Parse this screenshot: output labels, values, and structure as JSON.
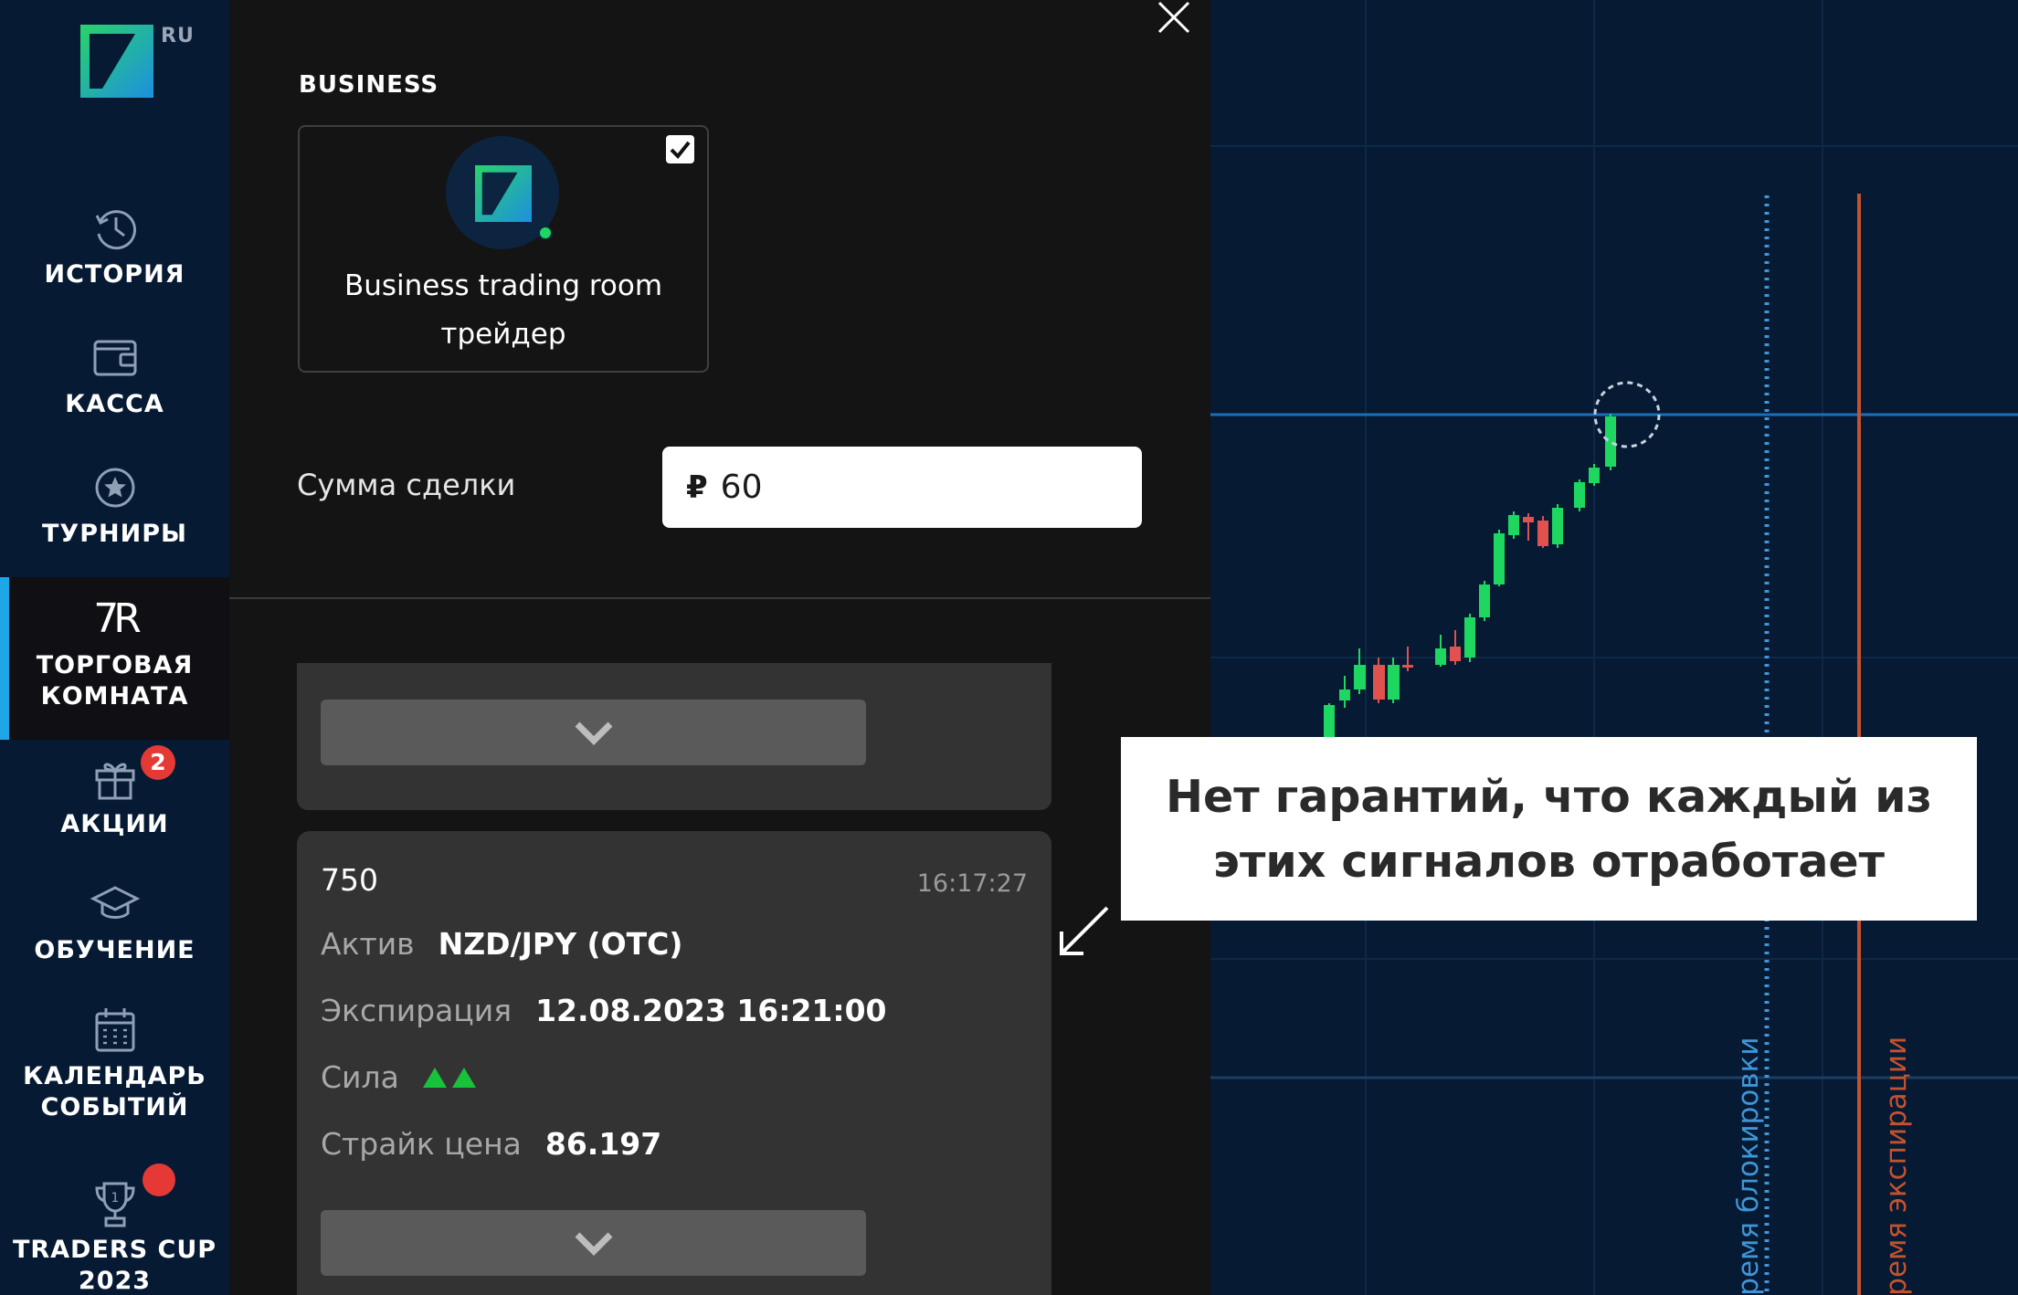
{
  "app": {
    "logo_region": "RU"
  },
  "sidebar": {
    "items": [
      {
        "id": "history",
        "label": "ИСТОРИЯ",
        "icon": "history-icon"
      },
      {
        "id": "cashier",
        "label": "КАССА",
        "icon": "wallet-icon"
      },
      {
        "id": "tournaments",
        "label": "ТУРНИРЫ",
        "icon": "star-icon"
      },
      {
        "id": "trading-room",
        "label": "ТОРГОВАЯ\nКОМНАТА",
        "icon": "trading-room-icon",
        "icon_text": "7R",
        "active": true
      },
      {
        "id": "promotions",
        "label": "АКЦИИ",
        "icon": "gift-icon",
        "badge": "2"
      },
      {
        "id": "education",
        "label": "ОБУЧЕНИЕ",
        "icon": "graduation-cap-icon"
      },
      {
        "id": "calendar",
        "label": "КАЛЕНДАРЬ\nСОБЫТИЙ",
        "icon": "calendar-icon"
      },
      {
        "id": "traders-cup",
        "label": "TRADERS CUP\n2023",
        "icon": "trophy-icon",
        "badge_dot": true
      }
    ]
  },
  "panel": {
    "section_title": "BUSINESS",
    "trader": {
      "name": "Business trading room\nтрейдер",
      "selected": true,
      "online": true
    },
    "amount": {
      "label": "Сумма сделки",
      "currency": "₽",
      "value": "60"
    },
    "signals": [
      {
        "amount": "750",
        "time": "16:17:27",
        "asset_label": "Актив",
        "asset": "NZD/JPY (OTC)",
        "expiration_label": "Экспирация",
        "expiration": "12.08.2023 16:21:00",
        "strength_label": "Сила",
        "strength": 2,
        "strike_label": "Страйк цена",
        "strike": "86.197"
      }
    ]
  },
  "chart": {
    "lock_line_label": "Время блокировки",
    "expiry_line_label": "Время экспирации",
    "colors": {
      "up": "#1ed760",
      "down": "#e0514f",
      "lock_line": "#3f95d6",
      "expiry_line": "#c4522e",
      "price_line": "#1b6fb4"
    }
  },
  "callout": {
    "text": "Нет гарантий, что каждый из\nэтих сигналов отработает"
  },
  "colors": {
    "sidebar_bg": "#061a33",
    "panel_bg": "#141414",
    "accent": "#1ea7e8",
    "badge": "#e53935"
  }
}
